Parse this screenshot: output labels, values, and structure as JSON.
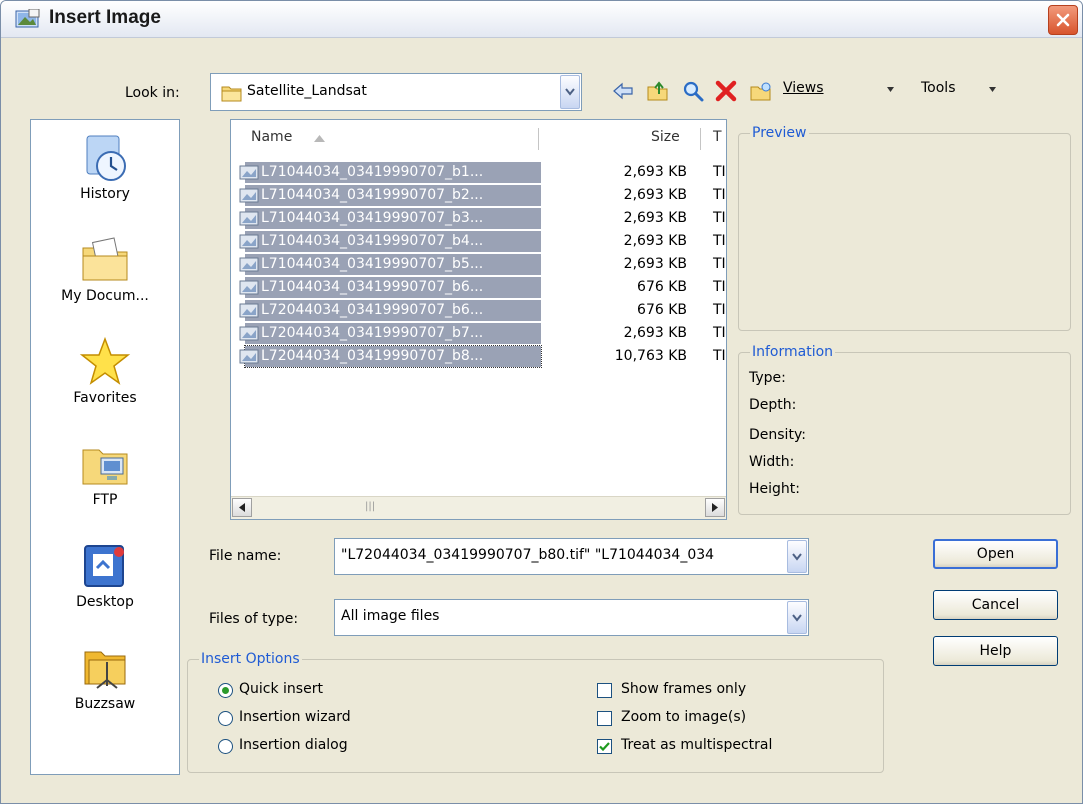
{
  "window": {
    "title": "Insert Image"
  },
  "look_in": {
    "label": "Look in:",
    "value": "Satellite_Landsat"
  },
  "toolbar": {
    "views_label": "Views",
    "tools_label": "Tools"
  },
  "places": [
    {
      "label": "History",
      "icon": "history-icon"
    },
    {
      "label": "My Docum...",
      "icon": "my-documents-icon"
    },
    {
      "label": "Favorites",
      "icon": "favorites-star-icon"
    },
    {
      "label": "FTP",
      "icon": "ftp-icon"
    },
    {
      "label": "Desktop",
      "icon": "desktop-icon"
    },
    {
      "label": "Buzzsaw",
      "icon": "buzzsaw-icon"
    }
  ],
  "file_list": {
    "columns": {
      "name": "Name",
      "size": "Size",
      "type": "T"
    },
    "rows": [
      {
        "name": "L71044034_03419990707_b1...",
        "size": "2,693 KB",
        "type": "TI"
      },
      {
        "name": "L71044034_03419990707_b2...",
        "size": "2,693 KB",
        "type": "TI"
      },
      {
        "name": "L71044034_03419990707_b3...",
        "size": "2,693 KB",
        "type": "TI"
      },
      {
        "name": "L71044034_03419990707_b4...",
        "size": "2,693 KB",
        "type": "TI"
      },
      {
        "name": "L71044034_03419990707_b5...",
        "size": "2,693 KB",
        "type": "TI"
      },
      {
        "name": "L71044034_03419990707_b6...",
        "size": "676 KB",
        "type": "TI"
      },
      {
        "name": "L72044034_03419990707_b6...",
        "size": "676 KB",
        "type": "TI"
      },
      {
        "name": "L72044034_03419990707_b7...",
        "size": "2,693 KB",
        "type": "TI"
      },
      {
        "name": "L72044034_03419990707_b8...",
        "size": "10,763 KB",
        "type": "TI"
      }
    ]
  },
  "preview": {
    "title": "Preview"
  },
  "information": {
    "title": "Information",
    "fields": [
      "Type:",
      "Depth:",
      "Density:",
      "Width:",
      "Height:"
    ]
  },
  "file_name": {
    "label": "File name:",
    "value": "\"L72044034_03419990707_b80.tif\" \"L71044034_034"
  },
  "files_of_type": {
    "label": "Files of type:",
    "value": "All image files"
  },
  "buttons": {
    "open": "Open",
    "cancel": "Cancel",
    "help": "Help"
  },
  "insert_options": {
    "title": "Insert Options",
    "radios": [
      {
        "label": "Quick insert",
        "selected": true
      },
      {
        "label": "Insertion wizard",
        "selected": false
      },
      {
        "label": "Insertion dialog",
        "selected": false
      }
    ],
    "checks": [
      {
        "label": "Show frames only",
        "checked": false
      },
      {
        "label": "Zoom to image(s)",
        "checked": false
      },
      {
        "label": "Treat as multispectral",
        "checked": true
      }
    ]
  },
  "colors": {
    "accent": "#1f5bd4",
    "selection": "#9aa2b5",
    "dialog_bg": "#ECE9D8"
  }
}
